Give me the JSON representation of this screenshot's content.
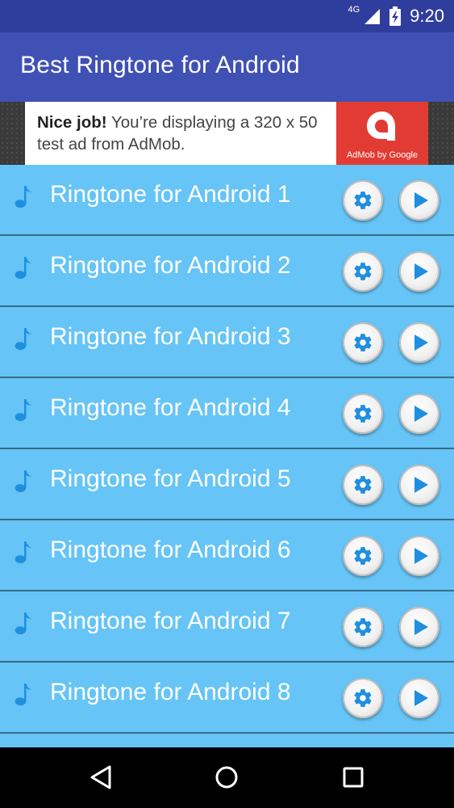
{
  "status_bar": {
    "network": "4G",
    "time": "9:20"
  },
  "app_bar": {
    "title": "Best Ringtone for Android"
  },
  "ad": {
    "headline": "Nice job!",
    "body": " You’re displaying a 320 x 50 test ad from AdMob.",
    "logo_caption": "AdMob by Google",
    "brand_color": "#e23b33"
  },
  "list": {
    "items": [
      {
        "label": "Ringtone for Android 1"
      },
      {
        "label": "Ringtone for Android 2"
      },
      {
        "label": "Ringtone for Android 3"
      },
      {
        "label": "Ringtone for Android 4"
      },
      {
        "label": "Ringtone for Android 5"
      },
      {
        "label": "Ringtone for Android 6"
      },
      {
        "label": "Ringtone for Android 7"
      },
      {
        "label": "Ringtone for Android 8"
      },
      {
        "label": ""
      }
    ],
    "item_icon": "music-note-icon",
    "actions": [
      "gear-icon",
      "play-icon"
    ]
  },
  "nav_bar": {
    "buttons": [
      "back-icon",
      "home-icon",
      "recents-icon"
    ]
  },
  "colors": {
    "status_bar": "#2f3d9c",
    "app_bar": "#3f51b5",
    "list_background": "#66c4f6",
    "accent_icon": "#1f8fe0",
    "divider": "#3a6b86"
  }
}
